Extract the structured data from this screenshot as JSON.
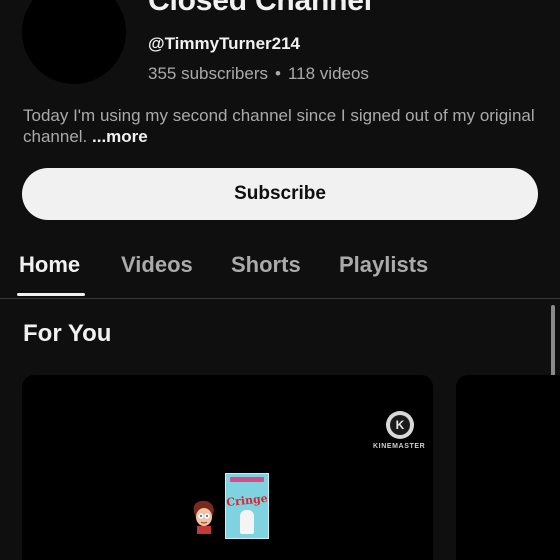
{
  "channel": {
    "title": "Closed Channel",
    "handle": "@TimmyTurner214",
    "subscribers": "355 subscribers",
    "separator": "•",
    "videos": "118 videos",
    "description": "Today I'm using my second channel since I signed out of my original channel.",
    "more_label": "...more"
  },
  "actions": {
    "subscribe_label": "Subscribe"
  },
  "tabs": [
    {
      "label": "Home",
      "active": true
    },
    {
      "label": "Videos",
      "active": false
    },
    {
      "label": "Shorts",
      "active": false
    },
    {
      "label": "Playlists",
      "active": false
    }
  ],
  "section": {
    "title": "For You"
  },
  "video_card": {
    "watermark_text": "KINEMASTER",
    "watermark_icon": "kinemaster-logo-icon",
    "thumbnail_text": "Cringe"
  },
  "colors": {
    "background": "#0f0f0f",
    "primary_text": "#f1f1f1",
    "secondary_text": "#aaaaaa",
    "subscribe_bg": "#f1f1f1"
  }
}
